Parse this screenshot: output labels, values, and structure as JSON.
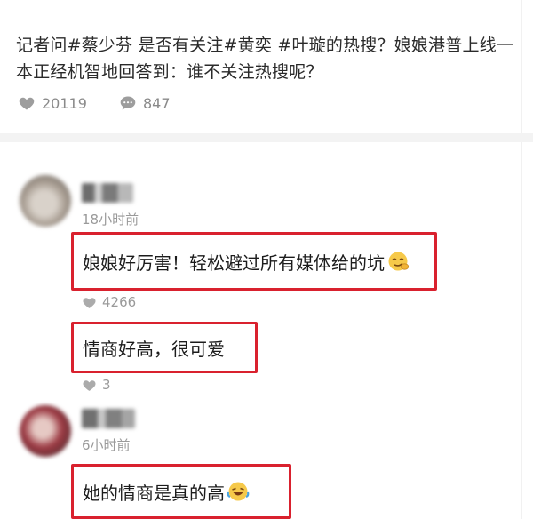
{
  "post": {
    "text": "记者问#蔡少芬 是否有关注#黄奕 #叶璇的热搜？娘娘港普上线一本正经机智地回答到：谁不关注热搜呢？"
  },
  "stats": {
    "likes": "20119",
    "comments": "847"
  },
  "comments": [
    {
      "time": "18小时前",
      "replies": [
        {
          "text": "娘娘好厉害！轻松避过所有媒体给的坑",
          "emoji": "smirk-emoji",
          "likes": "4266"
        },
        {
          "text": "情商好高，很可爱",
          "likes": "3"
        }
      ]
    },
    {
      "time": "6小时前",
      "replies": [
        {
          "text": "她的情商是真的高",
          "emoji": "laughing-tears-emoji"
        }
      ]
    }
  ],
  "colors": {
    "highlight_border": "#d9212e",
    "muted_text": "#9a9a9a"
  },
  "icons": {
    "like": "heart-icon",
    "comment": "speech-bubble-icon"
  }
}
